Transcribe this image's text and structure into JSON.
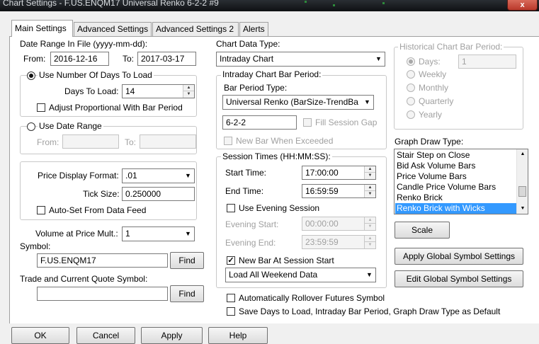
{
  "window": {
    "title": "Chart Settings - F.US.ENQM17  Universal Renko 6-2-2  #9",
    "close_label": "x"
  },
  "tabs": [
    "Main Settings",
    "Advanced Settings",
    "Advanced Settings 2",
    "Alerts"
  ],
  "date_range": {
    "label": "Date Range In File (yyyy-mm-dd):",
    "from_label": "From:",
    "from_value": "2016-12-16",
    "to_label": "To:",
    "to_value": "2017-03-17"
  },
  "days_group": {
    "radio_label": "Use Number Of Days To Load",
    "days_label": "Days To Load:",
    "days_value": "14",
    "adjust_label": "Adjust Proportional With Bar Period"
  },
  "date_range_group": {
    "radio_label": "Use Date Range",
    "from_label": "From:",
    "to_label": "To:"
  },
  "price": {
    "format_label": "Price Display Format:",
    "format_value": ".01",
    "tick_label": "Tick Size:",
    "tick_value": "0.250000",
    "autoset_label": "Auto-Set From Data Feed"
  },
  "volume": {
    "label": "Volume at Price Mult.:",
    "value": "1"
  },
  "symbol": {
    "label": "Symbol:",
    "value": "F.US.ENQM17",
    "find_label": "Find"
  },
  "trade_symbol": {
    "label": "Trade and Current Quote Symbol:",
    "value": "",
    "find_label": "Find"
  },
  "chart_type": {
    "label": "Chart Data Type:",
    "value": "Intraday Chart"
  },
  "intraday": {
    "group_label": "Intraday Chart Bar Period:",
    "type_label": "Bar Period Type:",
    "type_value": "Universal Renko (BarSize-TrendBa",
    "value": "6-2-2",
    "fill_label": "Fill Session Gap",
    "new_bar_label": "New Bar When Exceeded"
  },
  "session": {
    "group_label": "Session Times (HH:MM:SS):",
    "start_label": "Start Time:",
    "start_value": "17:00:00",
    "end_label": "End Time:",
    "end_value": "16:59:59",
    "use_evening_label": "Use Evening Session",
    "evening_start_label": "Evening Start:",
    "evening_start_value": "00:00:00",
    "evening_end_label": "Evening End:",
    "evening_end_value": "23:59:59",
    "new_bar_label": "New Bar At Session Start",
    "weekend_value": "Load All Weekend Data"
  },
  "options": {
    "rollover_label": "Automatically Rollover Futures Symbol",
    "save_default_label": "Save Days to Load, Intraday Bar Period, Graph Draw Type as Default"
  },
  "historical": {
    "group_label": "Historical Chart Bar Period:",
    "days_label": "Days:",
    "days_value": "1",
    "weekly_label": "Weekly",
    "monthly_label": "Monthly",
    "quarterly_label": "Quarterly",
    "yearly_label": "Yearly"
  },
  "graph_draw": {
    "label": "Graph Draw Type:",
    "items": [
      "Stair Step on Close",
      "Bid Ask Volume Bars",
      "Price Volume Bars",
      "Candle Price Volume Bars",
      "Renko Brick",
      "Renko Brick with Wicks"
    ],
    "selected": "Renko Brick with Wicks"
  },
  "buttons": {
    "scale": "Scale",
    "apply_global": "Apply Global Symbol Settings",
    "edit_global": "Edit Global Symbol Settings",
    "ok": "OK",
    "cancel": "Cancel",
    "apply": "Apply",
    "help": "Help"
  },
  "colors": {
    "selection": "#3399ff",
    "close": "#c0392b"
  }
}
